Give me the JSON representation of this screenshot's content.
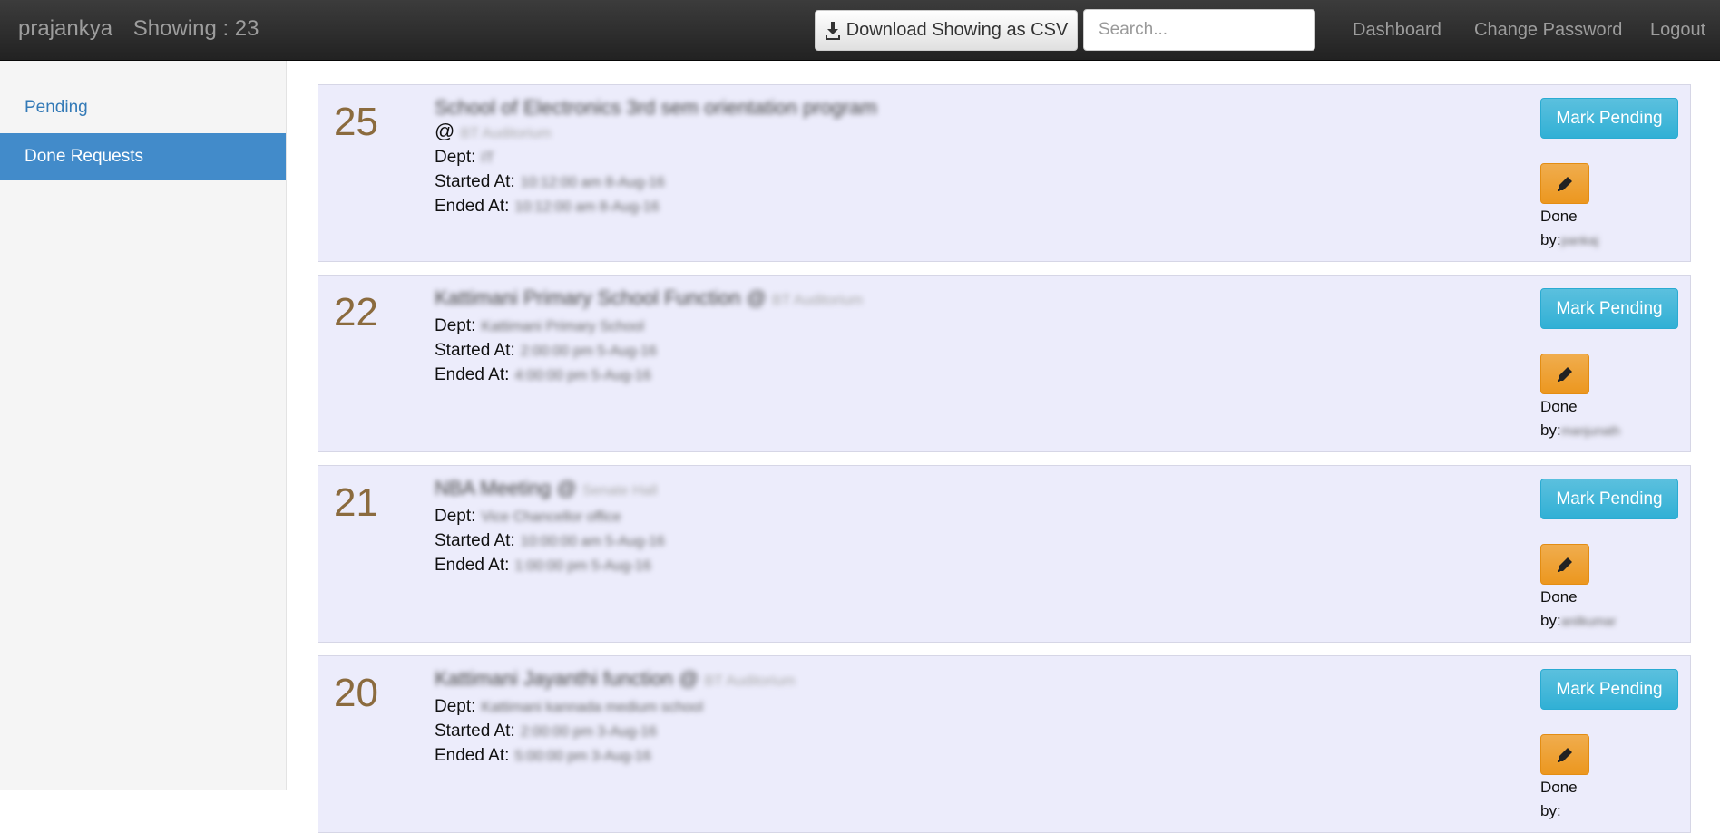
{
  "navbar": {
    "brand": "prajankya",
    "showing": "Showing : 23",
    "csv_button": "Download Showing as CSV",
    "search_placeholder": "Search...",
    "links": [
      "Dashboard",
      "Change Password",
      "Logout"
    ]
  },
  "sidebar": {
    "items": [
      {
        "label": "Pending"
      },
      {
        "label": "Done Requests"
      }
    ]
  },
  "cards": [
    {
      "number": "25",
      "title": "School of Electronics 3rd sem orientation program",
      "at_symbol": "@",
      "venue": "BT Auditorium",
      "dept_label": "Dept:",
      "dept": "IT",
      "started_label": "Started At:",
      "started": "10:12:00 am 8-Aug-16",
      "ended_label": "Ended At:",
      "ended": "10:12:00 am 8-Aug-16",
      "mark_button": "Mark Pending",
      "done_label": "Done",
      "by_label": "by:",
      "done_by": "pankaj"
    },
    {
      "number": "22",
      "title": "Kattimani Primary School Function @",
      "at_symbol": "",
      "venue": "BT Auditorium",
      "dept_label": "Dept:",
      "dept": "Kattimani Primary School",
      "started_label": "Started At:",
      "started": "2:00:00 pm 5-Aug-16",
      "ended_label": "Ended At:",
      "ended": "4:00:00 pm 5-Aug-16",
      "mark_button": "Mark Pending",
      "done_label": "Done",
      "by_label": "by:",
      "done_by": "manjunath"
    },
    {
      "number": "21",
      "title": "NBA Meeting @",
      "at_symbol": "",
      "venue": "Senate Hall",
      "dept_label": "Dept:",
      "dept": "Vice Chancellor office",
      "started_label": "Started At:",
      "started": "10:00:00 am 5-Aug-16",
      "ended_label": "Ended At:",
      "ended": "1:00:00 pm 5-Aug-16",
      "mark_button": "Mark Pending",
      "done_label": "Done",
      "by_label": "by:",
      "done_by": "anilkumar"
    },
    {
      "number": "20",
      "title": "Kattimani Jayanthi function @",
      "at_symbol": "",
      "venue": "BT Auditorium",
      "dept_label": "Dept:",
      "dept": "Kattimani kannada medium school",
      "started_label": "Started At:",
      "started": "2:00:00 pm 3-Aug-16",
      "ended_label": "Ended At:",
      "ended": "5:00:00 pm 3-Aug-16",
      "mark_button": "Mark Pending",
      "done_label": "Done",
      "by_label": "by:",
      "done_by": ""
    }
  ],
  "colors": {
    "navbar_bg": "#222222",
    "info_button": "#5bc0de",
    "warning_button": "#f0ad4e",
    "active_sidebar": "#428bca",
    "card_bg": "#ececfb",
    "number_color": "#8b6b3e"
  }
}
